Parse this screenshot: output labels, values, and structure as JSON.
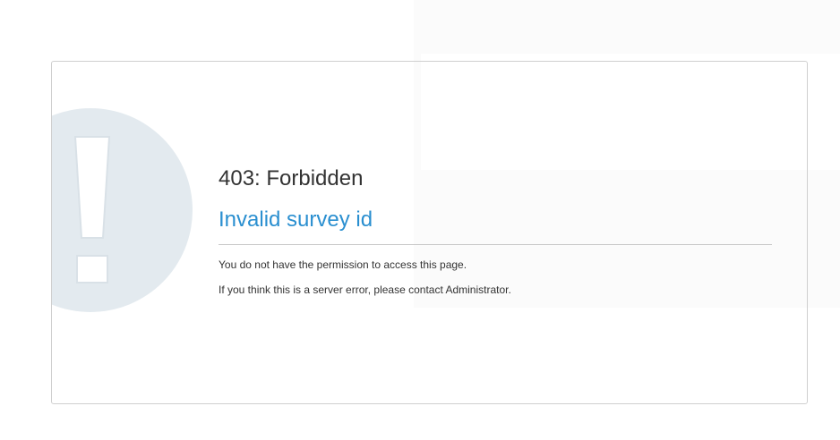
{
  "error": {
    "code_title": "403: Forbidden",
    "heading": "Invalid survey id",
    "message_permission": "You do not have the permission to access this page.",
    "message_contact": "If you think this is a server error, please contact Administrator."
  },
  "icons": {
    "warning": "exclamation-icon"
  },
  "colors": {
    "heading": "#2a8fd0",
    "text": "#333333",
    "icon_bg": "#e3eaef",
    "border": "#cfcfcf"
  }
}
